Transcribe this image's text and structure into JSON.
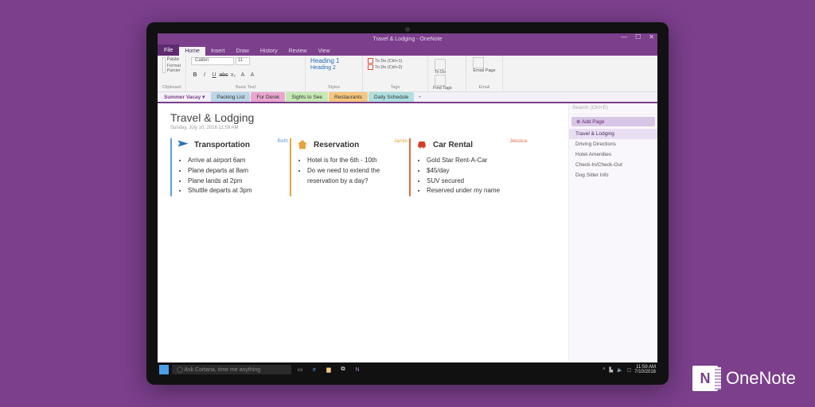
{
  "brand": {
    "icon_letter": "N",
    "name": "OneNote"
  },
  "titlebar": {
    "title": "Travel & Lodging - OneNote",
    "min": "—",
    "max": "☐",
    "close": "✕"
  },
  "ribbon_tabs": {
    "file": "File",
    "items": [
      "Home",
      "Insert",
      "Draw",
      "History",
      "Review",
      "View"
    ],
    "active": 0
  },
  "ribbon": {
    "clipboard": {
      "paste": "Paste",
      "format_painter": "Format Painter",
      "label": "Clipboard"
    },
    "font": {
      "family": "Calibri",
      "size": "11",
      "label": "Basic Text",
      "buttons": [
        "B",
        "I",
        "U",
        "abc",
        "x₂",
        "A",
        "A"
      ]
    },
    "styles": {
      "items": [
        "Heading 1",
        "Heading 2"
      ],
      "label": "Styles"
    },
    "tags": {
      "items": [
        "To Do (Ctrl+1)",
        "To Do (Ctrl+2)"
      ],
      "todo": "To Do",
      "find": "Find Tags",
      "label": "Tags"
    },
    "email": {
      "email_page": "Email Page",
      "label": "Email"
    }
  },
  "notebook": {
    "name": "Summer Vacay"
  },
  "sections": [
    "Packing List",
    "For Derek",
    "Sights to See",
    "Restaurants",
    "Daily Schedule"
  ],
  "page": {
    "title": "Travel & Lodging",
    "date": "Sunday, July 10, 2016    11:59 AM",
    "columns": [
      {
        "heading": "Transportation",
        "author": "Beth",
        "items": [
          "Arrive at airport 6am",
          "Plane departs at 8am",
          "Plane lands at 2pm",
          "Shuttle departs at 3pm"
        ]
      },
      {
        "heading": "Reservation",
        "author": "Jamie",
        "items": [
          "Hotel is for the 6th - 10th",
          "Do we need to extend the reservation by a day?"
        ]
      },
      {
        "heading": "Car Rental",
        "author": "Jessica",
        "items": [
          "Gold Star Rent-A-Car",
          "$45/day",
          "SUV secured",
          "Reserved under my name"
        ]
      }
    ]
  },
  "pagelist": {
    "search_placeholder": "Search (Ctrl+E)",
    "add": "Add Page",
    "items": [
      "Travel & Lodging",
      "Driving Directions",
      "Hotel Amenities",
      "Check-In/Check-Out",
      "Dog Sitter Info"
    ],
    "selected": 0
  },
  "taskbar": {
    "search_placeholder": "Ask Cortana, time me anything",
    "time": "11:59 AM",
    "date": "7/10/2016"
  }
}
